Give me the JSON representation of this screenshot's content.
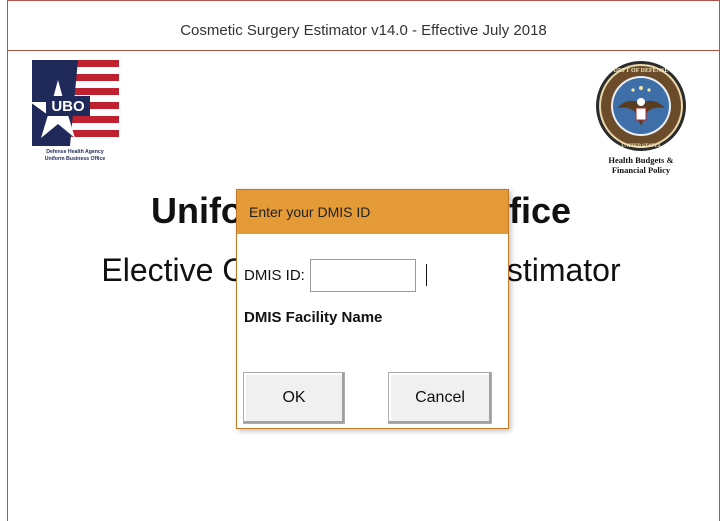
{
  "window": {
    "title": "Cosmetic Surgery Estimator v14.0 - Effective July 2018"
  },
  "logos": {
    "ubo": {
      "letters": "UBO",
      "line1": "Defense Health Agency",
      "line2": "Uniform Business Office",
      "icon": "ubo-logo-icon"
    },
    "dod": {
      "seal_text": "DEPARTMENT OF DEFENSE · UNITED STATES OF AMERICA",
      "caption_line1": "Health Budgets  &",
      "caption_line2": "Financial Policy",
      "icon": "dod-seal-icon"
    }
  },
  "background": {
    "heading_main": "Uniform Business Office",
    "heading_sub": "Elective Cosmetic Surgery Estimator"
  },
  "dialog": {
    "title": "Enter your DMIS ID",
    "dmis_label": "DMIS ID:",
    "dmis_value": "",
    "facility_label": "DMIS Facility Name",
    "ok_label": "OK",
    "cancel_label": "Cancel"
  },
  "colors": {
    "dialog_title_bg": "#e39a37",
    "window_border": "#b0524a",
    "ubo_navy": "#1f2a5a",
    "ubo_red": "#c0212f"
  }
}
